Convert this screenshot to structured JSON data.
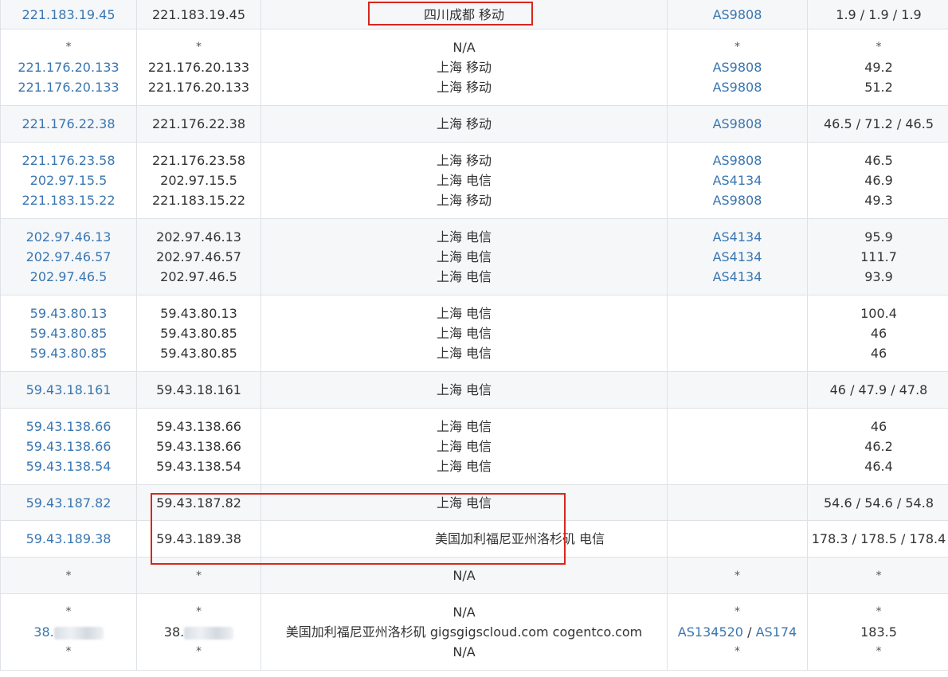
{
  "rows": [
    {
      "host": [
        "221.183.19.45"
      ],
      "ip": [
        "221.183.19.45"
      ],
      "loc": [
        "四川成都 移动"
      ],
      "asn": [
        "AS9808"
      ],
      "lat": [
        "1.9 / 1.9 / 1.9"
      ]
    },
    {
      "host": [
        "*",
        "221.176.20.133",
        "221.176.20.133"
      ],
      "ip": [
        "*",
        "221.176.20.133",
        "221.176.20.133"
      ],
      "loc": [
        "N/A",
        "上海 移动",
        "上海 移动"
      ],
      "asn": [
        "*",
        "AS9808",
        "AS9808"
      ],
      "lat": [
        "*",
        "49.2",
        "51.2"
      ]
    },
    {
      "host": [
        "221.176.22.38"
      ],
      "ip": [
        "221.176.22.38"
      ],
      "loc": [
        "上海 移动"
      ],
      "asn": [
        "AS9808"
      ],
      "lat": [
        "46.5 / 71.2 / 46.5"
      ]
    },
    {
      "host": [
        "221.176.23.58",
        "202.97.15.5",
        "221.183.15.22"
      ],
      "ip": [
        "221.176.23.58",
        "202.97.15.5",
        "221.183.15.22"
      ],
      "loc": [
        "上海 移动",
        "上海 电信",
        "上海 移动"
      ],
      "asn": [
        "AS9808",
        "AS4134",
        "AS9808"
      ],
      "lat": [
        "46.5",
        "46.9",
        "49.3"
      ]
    },
    {
      "host": [
        "202.97.46.13",
        "202.97.46.57",
        "202.97.46.5"
      ],
      "ip": [
        "202.97.46.13",
        "202.97.46.57",
        "202.97.46.5"
      ],
      "loc": [
        "上海 电信",
        "上海 电信",
        "上海 电信"
      ],
      "asn": [
        "AS4134",
        "AS4134",
        "AS4134"
      ],
      "lat": [
        "95.9",
        "111.7",
        "93.9"
      ]
    },
    {
      "host": [
        "59.43.80.13",
        "59.43.80.85",
        "59.43.80.85"
      ],
      "ip": [
        "59.43.80.13",
        "59.43.80.85",
        "59.43.80.85"
      ],
      "loc": [
        "上海 电信",
        "上海 电信",
        "上海 电信"
      ],
      "asn": [],
      "lat": [
        "100.4",
        "46",
        "46"
      ]
    },
    {
      "host": [
        "59.43.18.161"
      ],
      "ip": [
        "59.43.18.161"
      ],
      "loc": [
        "上海 电信"
      ],
      "asn": [],
      "lat": [
        "46 / 47.9 / 47.8"
      ]
    },
    {
      "host": [
        "59.43.138.66",
        "59.43.138.66",
        "59.43.138.54"
      ],
      "ip": [
        "59.43.138.66",
        "59.43.138.66",
        "59.43.138.54"
      ],
      "loc": [
        "上海 电信",
        "上海 电信",
        "上海 电信"
      ],
      "asn": [],
      "lat": [
        "46",
        "46.2",
        "46.4"
      ]
    },
    {
      "host": [
        "59.43.187.82"
      ],
      "ip": [
        "59.43.187.82"
      ],
      "loc": [
        "上海 电信"
      ],
      "asn": [],
      "lat": [
        "54.6 / 54.6 / 54.8"
      ]
    },
    {
      "host": [
        "59.43.189.38"
      ],
      "ip": [
        "59.43.189.38"
      ],
      "loc": [
        "美国加利福尼亚州洛杉矶 电信"
      ],
      "asn": [],
      "lat": [
        "178.3 / 178.5 / 178.4"
      ]
    },
    {
      "host": [
        "*"
      ],
      "ip": [
        "*"
      ],
      "loc": [
        "N/A"
      ],
      "asn": [
        "*"
      ],
      "lat": [
        "*"
      ]
    },
    {
      "host": [
        "*",
        "38.",
        "*"
      ],
      "ip": [
        "*",
        "38.",
        "*"
      ],
      "loc": [
        "N/A",
        "美国加利福尼亚州洛杉矶 gigsgigscloud.com cogentco.com",
        "N/A"
      ],
      "asn": [
        "*",
        "AS134520",
        "*"
      ],
      "asn_sep": "/",
      "asn_extra": "AS174",
      "lat": [
        "*",
        "183.5",
        "*"
      ]
    }
  ],
  "colors": {
    "link": "#3a76b0",
    "highlight": "#d9261c",
    "stripe": "#f5f7f9",
    "border": "#dee2e6"
  }
}
